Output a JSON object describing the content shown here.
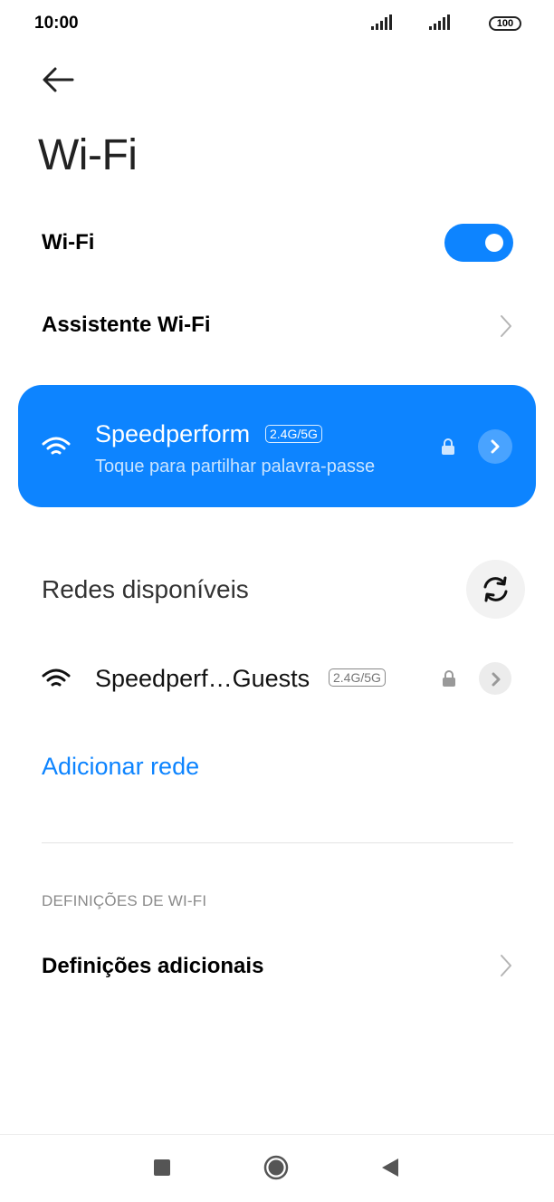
{
  "status_bar": {
    "time": "10:00",
    "battery": "100",
    "icons": [
      "signal-icon",
      "signal-icon",
      "battery-icon"
    ]
  },
  "header": {
    "back_icon": "arrow-left-icon",
    "title": "Wi-Fi"
  },
  "wifi_toggle_row": {
    "label": "Wi-Fi",
    "enabled": true
  },
  "assistant_row": {
    "label": "Assistente Wi-Fi",
    "icon": "chevron-right-icon"
  },
  "connected_network": {
    "name": "Speedperform",
    "band": "2.4G/5G",
    "subtitle": "Toque para partilhar palavra-passe",
    "secured": true,
    "icons": [
      "wifi-icon",
      "lock-icon",
      "chevron-right-icon"
    ]
  },
  "available_networks": {
    "heading": "Redes disponíveis",
    "refresh_icon": "refresh-icon",
    "items": [
      {
        "name": "Speedperf…Guests",
        "band": "2.4G/5G",
        "secured": true
      }
    ],
    "add_network_label": "Adicionar rede"
  },
  "wifi_settings": {
    "caption": "DEFINIÇÕES DE WI-FI",
    "additional_label": "Definições adicionais"
  },
  "nav_bar": {
    "icons": [
      "recent-apps-icon",
      "home-icon",
      "back-icon"
    ]
  },
  "colors": {
    "accent": "#0d84ff",
    "text": "#000000",
    "muted": "#8a8a8a"
  }
}
